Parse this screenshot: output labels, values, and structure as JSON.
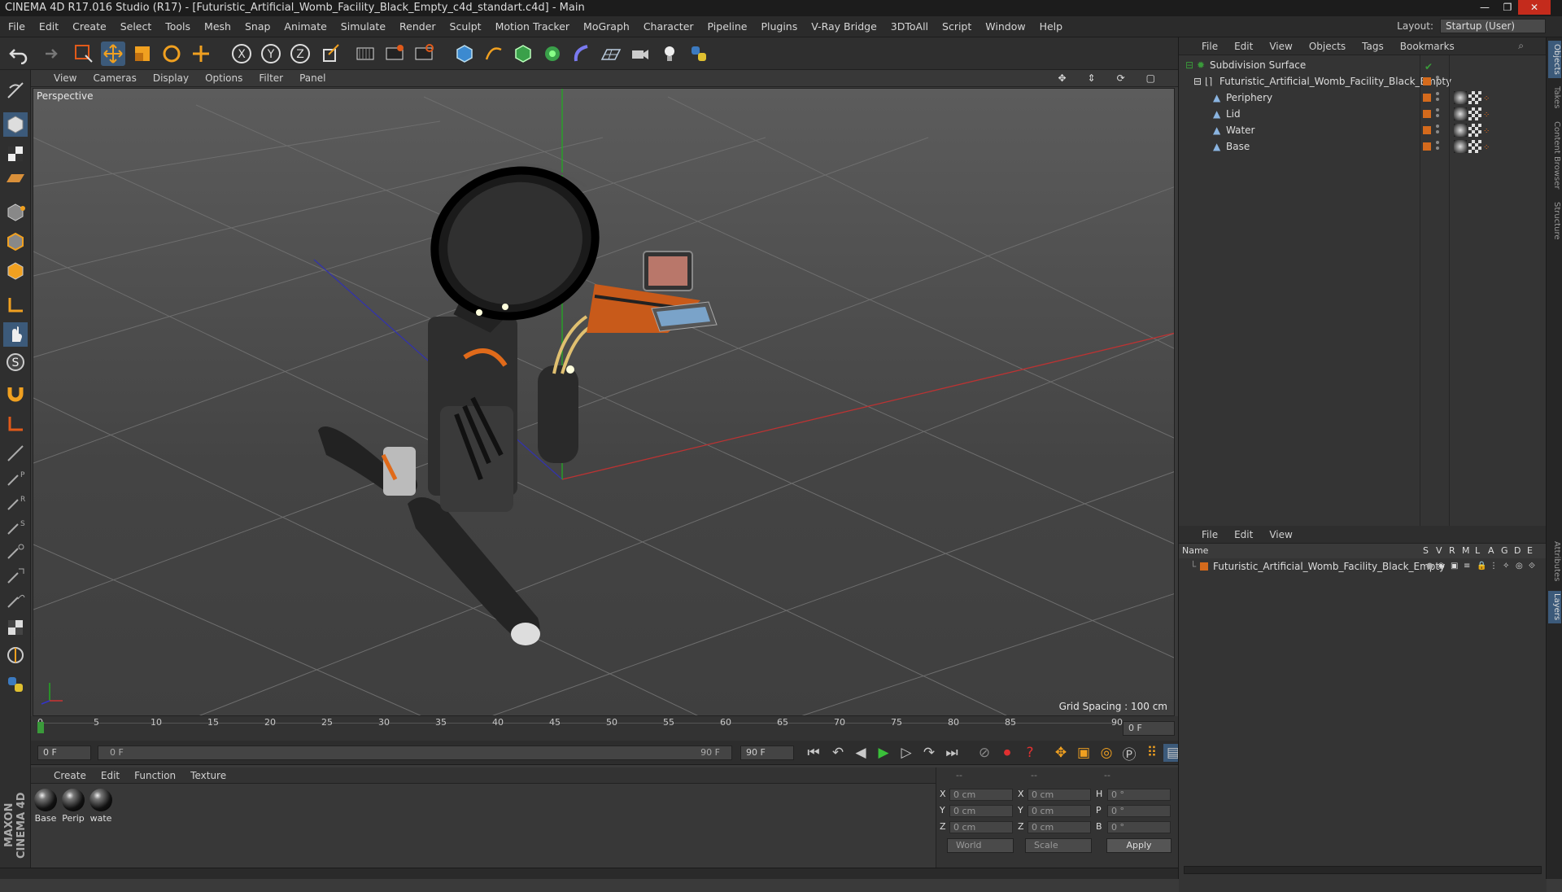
{
  "window": {
    "title": "CINEMA 4D R17.016 Studio (R17) - [Futuristic_Artificial_Womb_Facility_Black_Empty_c4d_standart.c4d] - Main",
    "controls": [
      "minimize-icon",
      "restore-icon",
      "close-icon"
    ]
  },
  "menubar": {
    "items": [
      "File",
      "Edit",
      "Create",
      "Select",
      "Tools",
      "Mesh",
      "Snap",
      "Animate",
      "Simulate",
      "Render",
      "Sculpt",
      "Motion Tracker",
      "MoGraph",
      "Character",
      "Pipeline",
      "Plugins",
      "V-Ray Bridge",
      "3DToAll",
      "Script",
      "Window",
      "Help"
    ],
    "layout_label": "Layout:",
    "layout_value": "Startup (User)"
  },
  "viewport": {
    "menu": [
      "View",
      "Cameras",
      "Display",
      "Options",
      "Filter",
      "Panel"
    ],
    "label": "Perspective",
    "grid_spacing": "Grid Spacing : 100 cm"
  },
  "timeline": {
    "ticks": [
      "0",
      "5",
      "10",
      "15",
      "20",
      "25",
      "30",
      "35",
      "40",
      "45",
      "50",
      "55",
      "60",
      "65",
      "70",
      "75",
      "80",
      "85",
      "90"
    ],
    "current_frame": "0 F",
    "start_frame": "0 F",
    "range_start": "0 F",
    "range_end": "90 F",
    "end_frame": "90 F"
  },
  "materials": {
    "menu": [
      "Create",
      "Edit",
      "Function",
      "Texture"
    ],
    "items": [
      "Base",
      "Perip",
      "wate"
    ]
  },
  "coordinates": {
    "headers": [
      "--",
      "--",
      "--"
    ],
    "rows": [
      {
        "a": "X",
        "av": "0 cm",
        "b": "X",
        "bv": "0 cm",
        "c": "H",
        "cv": "0 °"
      },
      {
        "a": "Y",
        "av": "0 cm",
        "b": "Y",
        "bv": "0 cm",
        "c": "P",
        "cv": "0 °"
      },
      {
        "a": "Z",
        "av": "0 cm",
        "b": "Z",
        "bv": "0 cm",
        "c": "B",
        "cv": "0 °"
      }
    ],
    "world": "World",
    "scale": "Scale",
    "apply": "Apply"
  },
  "objects_panel": {
    "menu": [
      "File",
      "Edit",
      "View",
      "Objects",
      "Tags",
      "Bookmarks"
    ],
    "items": [
      {
        "name": "Subdivision Surface",
        "color": "#3a9a3a"
      },
      {
        "name": "Futuristic_Artificial_Womb_Facility_Black_Empty",
        "color": "#d46a1c"
      },
      {
        "name": "Periphery",
        "color": "#d46a1c"
      },
      {
        "name": "Lid",
        "color": "#d46a1c"
      },
      {
        "name": "Water",
        "color": "#d46a1c"
      },
      {
        "name": "Base",
        "color": "#d46a1c"
      }
    ]
  },
  "layers_panel": {
    "menu": [
      "File",
      "Edit",
      "View"
    ],
    "columns": [
      "Name",
      "S",
      "V",
      "R",
      "M",
      "L",
      "A",
      "G",
      "D",
      "E"
    ],
    "items": [
      {
        "name": "Futuristic_Artificial_Womb_Facility_Black_Empty",
        "color": "#d46a1c"
      }
    ]
  },
  "side_tabs": [
    "Objects",
    "Takes",
    "Content Browser",
    "Structure",
    "Attributes",
    "Layers"
  ],
  "brand": "MAXON CINEMA 4D",
  "colors": {
    "accent_orange": "#d46a1c",
    "active_blue": "#4a8ac8"
  }
}
